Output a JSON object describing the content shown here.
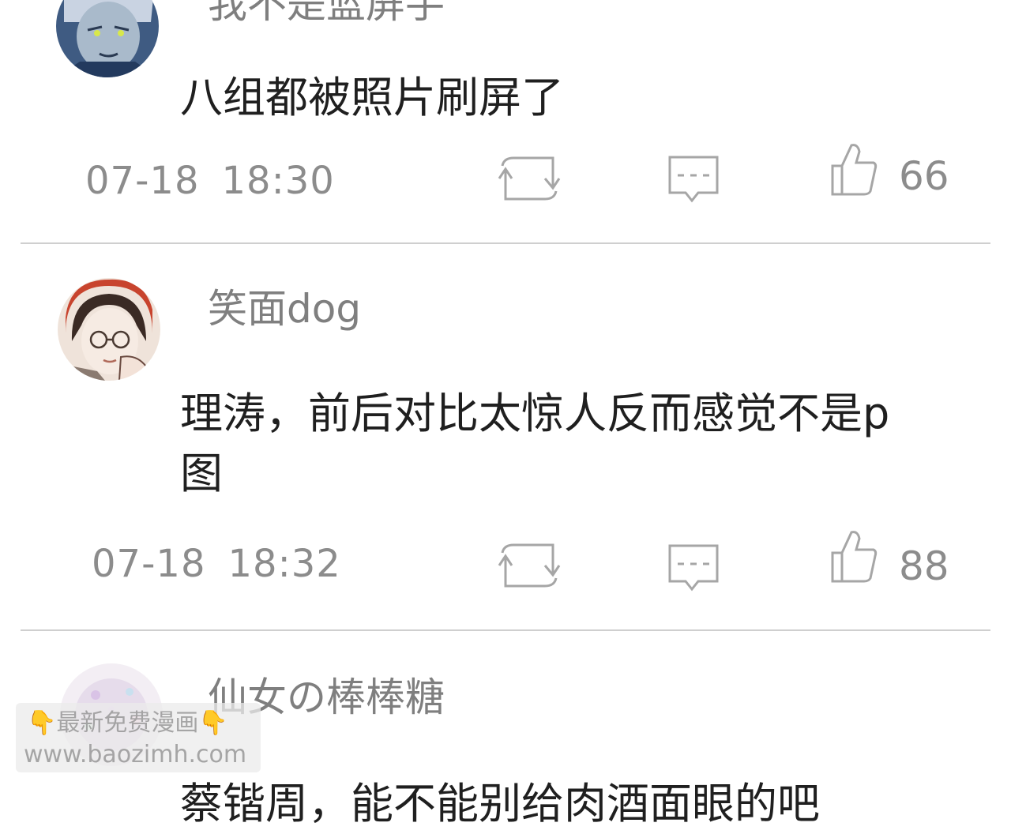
{
  "comments": [
    {
      "username": "我不是蓝屏手",
      "content": "八组都被照片刷屏了",
      "date": "07-18",
      "time": "18:30",
      "likes": "66"
    },
    {
      "username": "笑面dog",
      "content": "理涛，前后对比太惊人反而感觉不是p图",
      "date": "07-18",
      "time": "18:32",
      "likes": "88"
    },
    {
      "username": "仙女の棒棒糖",
      "content": "蔡锴周，能不能别给肉酒面眼的吧"
    }
  ],
  "icons": {
    "repost": "repost-icon",
    "reply": "comment-icon",
    "like": "thumbs-up-icon"
  },
  "watermark": {
    "line1": "最新免费漫画",
    "line2": "www.baozimh.com",
    "emoji": "👇"
  },
  "colors": {
    "username": "#7f7f7f",
    "content": "#1f1f1f",
    "meta": "#8c8c8c",
    "divider": "#cfcfcf"
  }
}
